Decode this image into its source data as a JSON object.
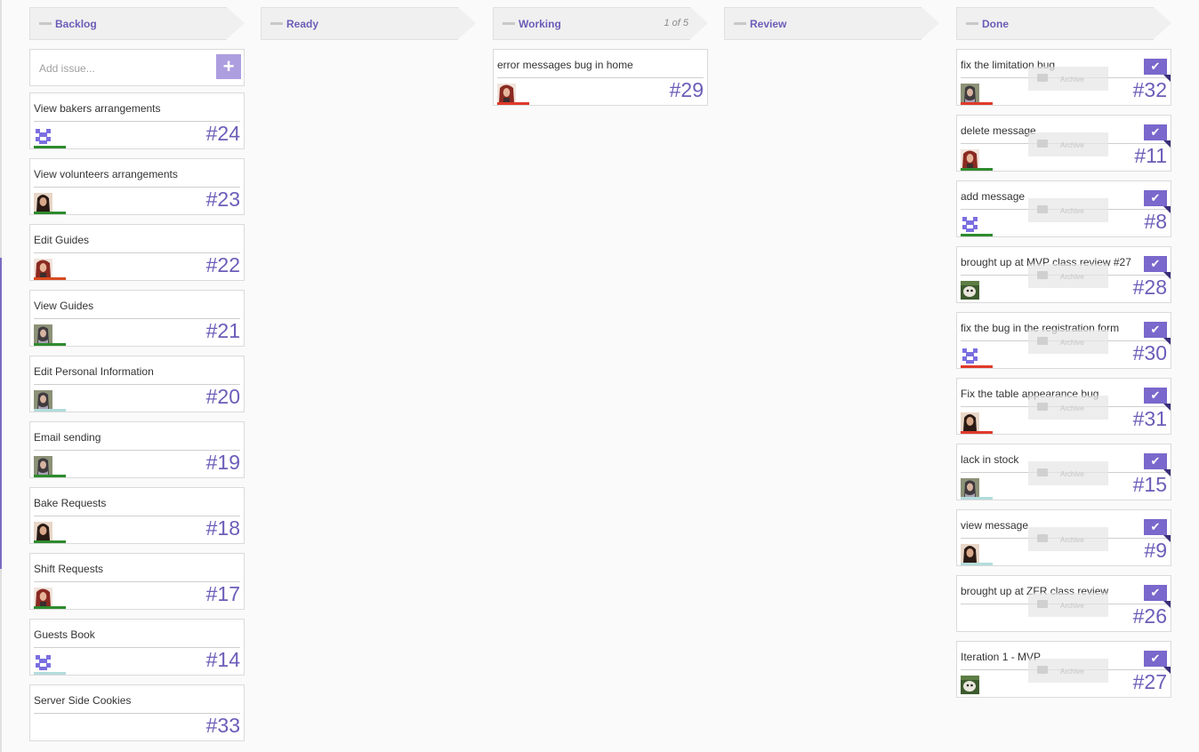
{
  "columns": {
    "backlog": {
      "title": "Backlog"
    },
    "ready": {
      "title": "Ready"
    },
    "working": {
      "title": "Working",
      "count": "1 of 5"
    },
    "review": {
      "title": "Review"
    },
    "done": {
      "title": "Done"
    }
  },
  "add_issue": {
    "placeholder": "Add issue...",
    "button": "+"
  },
  "backlog_cards": [
    {
      "title": "View bakers arrangements",
      "number": "#24",
      "priority": "green",
      "avatar": "identicon-icon"
    },
    {
      "title": "View volunteers arrangements",
      "number": "#23",
      "priority": "green",
      "avatar": "photo-woman-dark-icon"
    },
    {
      "title": "Edit Guides",
      "number": "#22",
      "priority": "orange",
      "avatar": "photo-woman-red-icon"
    },
    {
      "title": "View Guides",
      "number": "#21",
      "priority": "green",
      "avatar": "photo-woman-scarf-icon"
    },
    {
      "title": "Edit Personal Information",
      "number": "#20",
      "priority": "teal",
      "avatar": "photo-woman-scarf-icon"
    },
    {
      "title": "Email sending",
      "number": "#19",
      "priority": "green",
      "avatar": "photo-woman-scarf-icon"
    },
    {
      "title": "Bake Requests",
      "number": "#18",
      "priority": "green",
      "avatar": "photo-woman-dark-icon"
    },
    {
      "title": "Shift Requests",
      "number": "#17",
      "priority": "green",
      "avatar": "photo-woman-red-icon"
    },
    {
      "title": "Guests Book",
      "number": "#14",
      "priority": "teal",
      "avatar": "identicon-icon"
    },
    {
      "title": "Server Side Cookies",
      "number": "#33",
      "priority": "none",
      "avatar": "none"
    }
  ],
  "working_cards": [
    {
      "title": "error messages bug in home",
      "number": "#29",
      "priority": "red",
      "avatar": "photo-woman-red-icon"
    }
  ],
  "done_cards": [
    {
      "title": "fix the limitation bug",
      "number": "#32",
      "priority": "red",
      "avatar": "photo-woman-scarf-icon"
    },
    {
      "title": "delete message",
      "number": "#11",
      "priority": "green",
      "avatar": "photo-woman-red-icon"
    },
    {
      "title": "add message",
      "number": "#8",
      "priority": "green",
      "avatar": "identicon-icon"
    },
    {
      "title": "brought up at MVP class review #27",
      "number": "#28",
      "priority": "none",
      "avatar": "photo-animal-icon"
    },
    {
      "title": "fix the bug in the registration form",
      "number": "#30",
      "priority": "red",
      "avatar": "identicon-icon"
    },
    {
      "title": "Fix the table appearance bug",
      "number": "#31",
      "priority": "red",
      "avatar": "photo-woman-dark-icon"
    },
    {
      "title": "lack in stock",
      "number": "#15",
      "priority": "teal",
      "avatar": "photo-woman-scarf-icon"
    },
    {
      "title": "view message",
      "number": "#9",
      "priority": "teal",
      "avatar": "photo-woman-dark-icon"
    },
    {
      "title": "brought up at ZFR class review",
      "number": "#26",
      "priority": "none",
      "avatar": "none"
    },
    {
      "title": "Iteration 1 - MVP",
      "number": "#27",
      "priority": "none",
      "avatar": "photo-animal-icon"
    }
  ],
  "archive_label": "Archive",
  "check_glyph": "✔",
  "colors": {
    "accent": "#6b5db8",
    "check_bg": "#7a68cc",
    "add_button_bg": "#ad9ee0",
    "prio_green": "#2e8b2e",
    "prio_red": "#e03a2a",
    "prio_orange": "#d94a1f",
    "prio_teal": "#b2dcdc"
  }
}
